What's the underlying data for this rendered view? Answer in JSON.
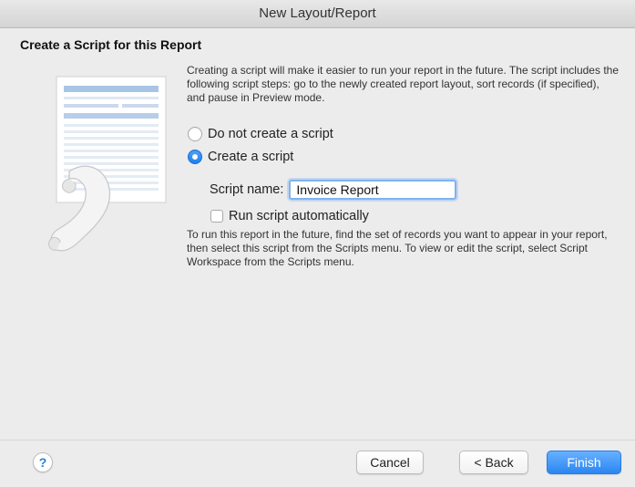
{
  "window": {
    "title": "New Layout/Report"
  },
  "heading": "Create a Script for this Report",
  "intro_text": "Creating a script will make it easier to run your report in the future. The script includes the following script steps: go to the newly created report layout, sort records (if specified), and pause in Preview mode.",
  "options": {
    "no_script": {
      "label": "Do not create a script",
      "selected": false
    },
    "create_script": {
      "label": "Create a script",
      "selected": true
    }
  },
  "script_name": {
    "label": "Script name:",
    "value": "Invoice Report"
  },
  "run_automatically": {
    "label": "Run script automatically",
    "checked": false
  },
  "help_text": "To run this report in the future, find the set of records you want to appear in your report, then select this script from the Scripts menu. To view or edit the script, select Script Workspace from the Scripts menu.",
  "footer": {
    "help_icon": "question-mark-icon",
    "help_glyph": "?",
    "cancel_label": "Cancel",
    "back_label": "< Back",
    "finish_label": "Finish"
  },
  "colors": {
    "accent": "#2b86f2",
    "background": "#ececec"
  }
}
